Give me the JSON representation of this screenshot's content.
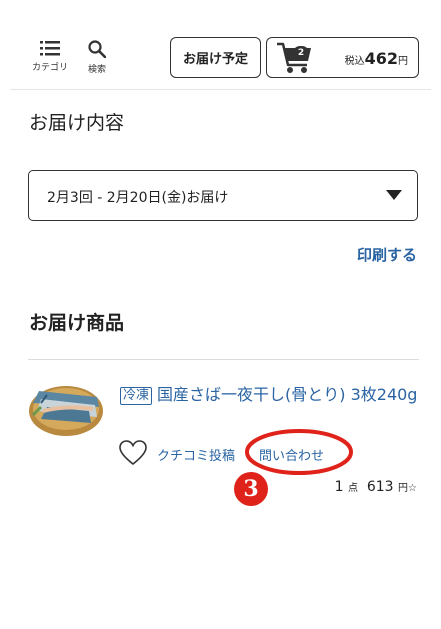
{
  "header": {
    "category_label": "カテゴリ",
    "search_label": "検索",
    "schedule_label": "お届け予定",
    "cart": {
      "count": "2",
      "price_prefix": "税込",
      "price": "462",
      "price_unit": "円"
    }
  },
  "delivery": {
    "title": "お届け内容",
    "selected_date": "2月3回 - 2月20日(金)お届け",
    "print_label": "印刷する"
  },
  "items": {
    "title": "お届け商品",
    "product": {
      "badge": "冷凍",
      "name": "国産さば一夜干し(骨とり) 3枚240g",
      "review_label": "クチコミ投稿",
      "contact_label": "問い合わせ",
      "qty": "1",
      "qty_unit": "点",
      "price": "613",
      "price_unit": "円☆"
    }
  },
  "annotation": {
    "step_number": "3",
    "highlight_color": "#e0231a"
  },
  "colors": {
    "link": "#2a64a3",
    "accent": "#e0231a"
  }
}
